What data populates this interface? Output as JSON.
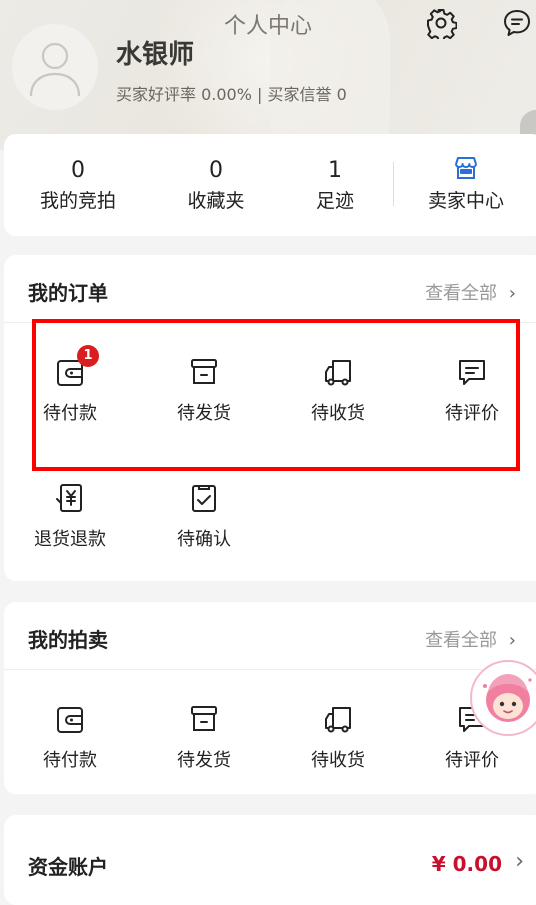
{
  "header": {
    "title": "个人中心",
    "username": "水银师",
    "rating_text": "买家好评率 0.00% | 买家信誉 0"
  },
  "stats": [
    {
      "value": "0",
      "label": "我的竞拍"
    },
    {
      "value": "0",
      "label": "收藏夹"
    },
    {
      "value": "1",
      "label": "足迹"
    }
  ],
  "seller_center": {
    "label": "卖家中心"
  },
  "orders": {
    "title": "我的订单",
    "more": "查看全部",
    "items": [
      {
        "label": "待付款",
        "badge": "1"
      },
      {
        "label": "待发货"
      },
      {
        "label": "待收货"
      },
      {
        "label": "待评价"
      },
      {
        "label": "退货退款"
      },
      {
        "label": "待确认"
      }
    ]
  },
  "auctions": {
    "title": "我的拍卖",
    "more": "查看全部",
    "items": [
      {
        "label": "待付款"
      },
      {
        "label": "待发货"
      },
      {
        "label": "待收货"
      },
      {
        "label": "待评价"
      }
    ]
  },
  "funds": {
    "title": "资金账户",
    "amount": "¥ 0.00"
  },
  "colors": {
    "accent_red": "#c8102e",
    "badge_red": "#d81e1e",
    "highlight": "#ff0000",
    "seller_icon_blue": "#2a6fd6"
  }
}
